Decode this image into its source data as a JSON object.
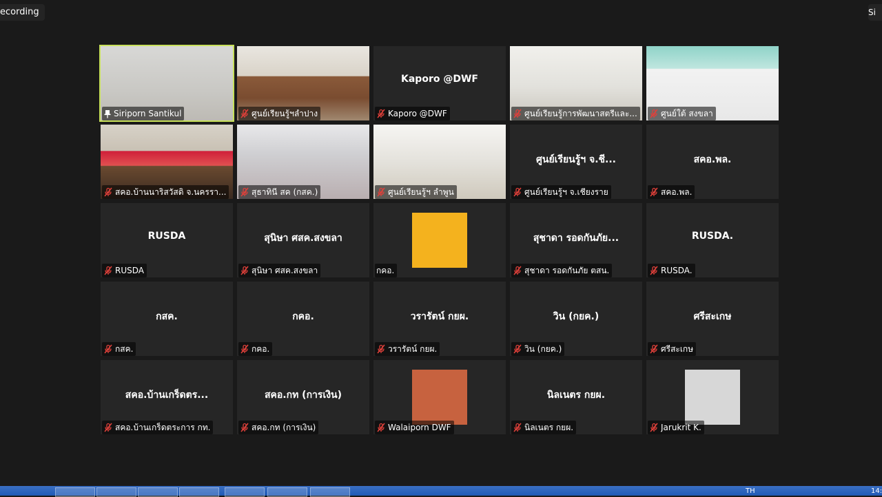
{
  "topbar": {
    "recording_label": "ecording",
    "view_label": "Si"
  },
  "participants": [
    {
      "display": "",
      "tag": "Siriporn Santikul",
      "muted": false,
      "pinned": true,
      "active": true,
      "scene": "s1"
    },
    {
      "display": "",
      "tag": "ศูนย์เรียนรู้ฯลำปาง",
      "muted": true,
      "scene": "s2"
    },
    {
      "display": "Kaporo @DWF",
      "tag": "Kaporo @DWF",
      "muted": true
    },
    {
      "display": "",
      "tag": "ศูนย์เรียนรู้การพัฒนาสตรีและ...",
      "muted": true,
      "scene": "s4"
    },
    {
      "display": "",
      "tag": "ศูนย์ใต้ สงขลา",
      "muted": true,
      "scene": "s5"
    },
    {
      "display": "",
      "tag": "สคอ.บ้านนาริสวัสดิ จ.นครรา...",
      "muted": true,
      "scene": "s6"
    },
    {
      "display": "",
      "tag": "สุธาทินี สค (กสค.)",
      "muted": true,
      "scene": "s7"
    },
    {
      "display": "",
      "tag": "ศูนย์เรียนรู้ฯ ลำพูน",
      "muted": true,
      "scene": "s8"
    },
    {
      "display": "ศูนย์เรียนรู้ฯ จ.ชี...",
      "tag": "ศูนย์เรียนรู้ฯ จ.เชียงราย",
      "muted": true
    },
    {
      "display": "สคอ.พล.",
      "tag": "สคอ.พล.",
      "muted": true
    },
    {
      "display": "RUSDA",
      "tag": "RUSDA",
      "muted": true
    },
    {
      "display": "สุนิษา ศสค.สงขลา",
      "tag": "สุนิษา ศสค.สงขลา",
      "muted": true
    },
    {
      "display": "",
      "tag": "กคอ.",
      "muted": false,
      "avatar": "avatar-kgo"
    },
    {
      "display": "สุชาดา รอดกันภัย...",
      "tag": "สุชาดา รอดกันภัย ตสน.",
      "muted": true
    },
    {
      "display": "RUSDA.",
      "tag": "RUSDA.",
      "muted": true
    },
    {
      "display": "กสค.",
      "tag": "กสค.",
      "muted": true
    },
    {
      "display": "กคอ.",
      "tag": "กคอ.",
      "muted": true
    },
    {
      "display": "วรารัตน์ กยผ.",
      "tag": "วรารัตน์ กยผ.",
      "muted": true
    },
    {
      "display": "วิน (กยค.)",
      "tag": "วิน (กยค.)",
      "muted": true
    },
    {
      "display": "ศรีสะเกษ",
      "tag": "ศรีสะเกษ",
      "muted": true
    },
    {
      "display": "สคอ.บ้านเกร็ดตร...",
      "tag": "สคอ.บ้านเกร็ดตระการ กท.",
      "muted": true
    },
    {
      "display": "สคอ.กท (การเงิน)",
      "tag": "สคอ.กท (การเงิน)",
      "muted": true
    },
    {
      "display": "",
      "tag": "Walaiporn DWF",
      "muted": true,
      "avatar": "avatar-wal"
    },
    {
      "display": "นิลเนตร กยผ.",
      "tag": "นิลเนตร กยผ.",
      "muted": true
    },
    {
      "display": "",
      "tag": "Jarukrit K.",
      "muted": true,
      "avatar": "avatar-jar"
    }
  ],
  "taskbar": {
    "lang": "TH",
    "clock": "14:"
  },
  "colors": {
    "active_border": "#c7e05a",
    "mute_icon": "#e0403a",
    "tile_bg": "#262626"
  }
}
